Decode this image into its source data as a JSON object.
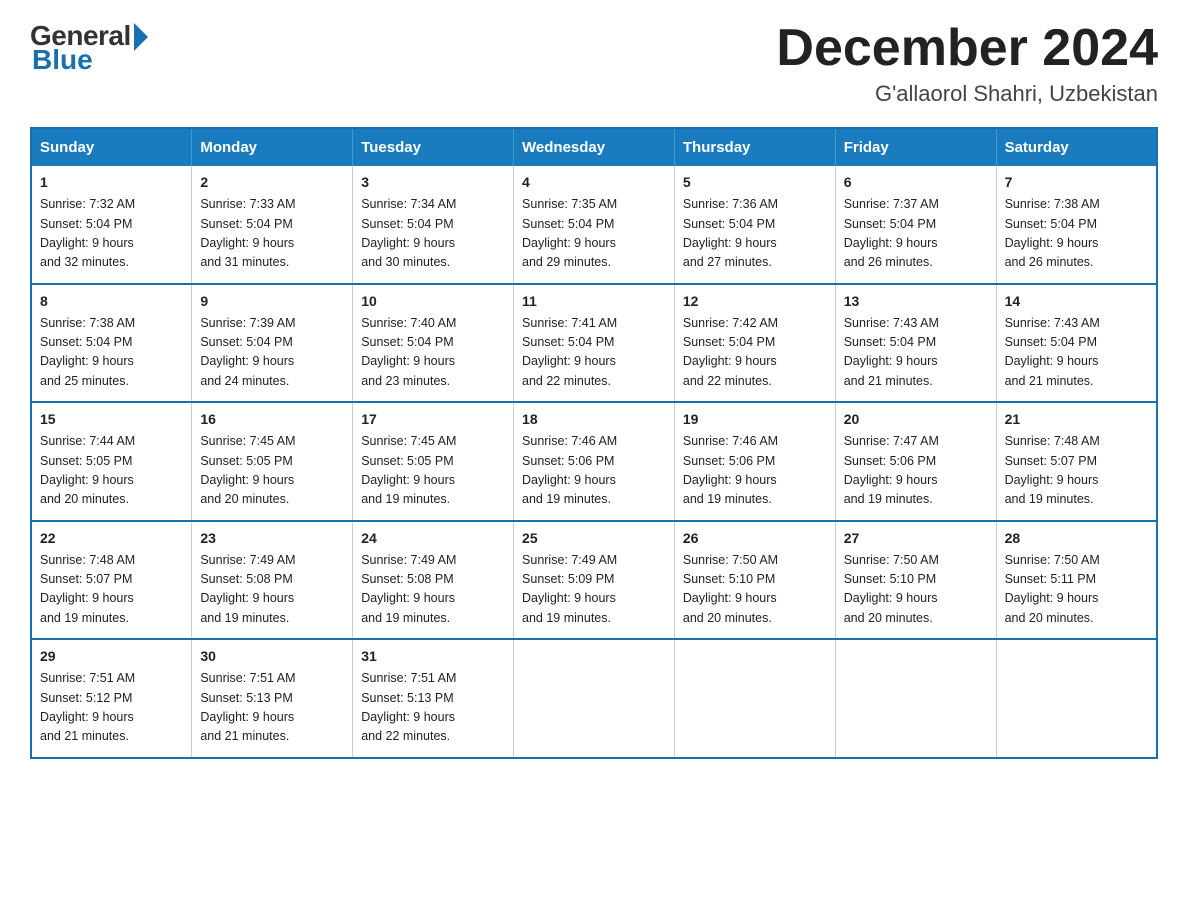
{
  "header": {
    "logo_general": "General",
    "logo_blue": "Blue",
    "month_title": "December 2024",
    "location": "G'allaorol Shahri, Uzbekistan"
  },
  "days_of_week": [
    "Sunday",
    "Monday",
    "Tuesday",
    "Wednesday",
    "Thursday",
    "Friday",
    "Saturday"
  ],
  "weeks": [
    [
      {
        "day": "1",
        "sunrise": "7:32 AM",
        "sunset": "5:04 PM",
        "daylight": "9 hours and 32 minutes."
      },
      {
        "day": "2",
        "sunrise": "7:33 AM",
        "sunset": "5:04 PM",
        "daylight": "9 hours and 31 minutes."
      },
      {
        "day": "3",
        "sunrise": "7:34 AM",
        "sunset": "5:04 PM",
        "daylight": "9 hours and 30 minutes."
      },
      {
        "day": "4",
        "sunrise": "7:35 AM",
        "sunset": "5:04 PM",
        "daylight": "9 hours and 29 minutes."
      },
      {
        "day": "5",
        "sunrise": "7:36 AM",
        "sunset": "5:04 PM",
        "daylight": "9 hours and 27 minutes."
      },
      {
        "day": "6",
        "sunrise": "7:37 AM",
        "sunset": "5:04 PM",
        "daylight": "9 hours and 26 minutes."
      },
      {
        "day": "7",
        "sunrise": "7:38 AM",
        "sunset": "5:04 PM",
        "daylight": "9 hours and 26 minutes."
      }
    ],
    [
      {
        "day": "8",
        "sunrise": "7:38 AM",
        "sunset": "5:04 PM",
        "daylight": "9 hours and 25 minutes."
      },
      {
        "day": "9",
        "sunrise": "7:39 AM",
        "sunset": "5:04 PM",
        "daylight": "9 hours and 24 minutes."
      },
      {
        "day": "10",
        "sunrise": "7:40 AM",
        "sunset": "5:04 PM",
        "daylight": "9 hours and 23 minutes."
      },
      {
        "day": "11",
        "sunrise": "7:41 AM",
        "sunset": "5:04 PM",
        "daylight": "9 hours and 22 minutes."
      },
      {
        "day": "12",
        "sunrise": "7:42 AM",
        "sunset": "5:04 PM",
        "daylight": "9 hours and 22 minutes."
      },
      {
        "day": "13",
        "sunrise": "7:43 AM",
        "sunset": "5:04 PM",
        "daylight": "9 hours and 21 minutes."
      },
      {
        "day": "14",
        "sunrise": "7:43 AM",
        "sunset": "5:04 PM",
        "daylight": "9 hours and 21 minutes."
      }
    ],
    [
      {
        "day": "15",
        "sunrise": "7:44 AM",
        "sunset": "5:05 PM",
        "daylight": "9 hours and 20 minutes."
      },
      {
        "day": "16",
        "sunrise": "7:45 AM",
        "sunset": "5:05 PM",
        "daylight": "9 hours and 20 minutes."
      },
      {
        "day": "17",
        "sunrise": "7:45 AM",
        "sunset": "5:05 PM",
        "daylight": "9 hours and 19 minutes."
      },
      {
        "day": "18",
        "sunrise": "7:46 AM",
        "sunset": "5:06 PM",
        "daylight": "9 hours and 19 minutes."
      },
      {
        "day": "19",
        "sunrise": "7:46 AM",
        "sunset": "5:06 PM",
        "daylight": "9 hours and 19 minutes."
      },
      {
        "day": "20",
        "sunrise": "7:47 AM",
        "sunset": "5:06 PM",
        "daylight": "9 hours and 19 minutes."
      },
      {
        "day": "21",
        "sunrise": "7:48 AM",
        "sunset": "5:07 PM",
        "daylight": "9 hours and 19 minutes."
      }
    ],
    [
      {
        "day": "22",
        "sunrise": "7:48 AM",
        "sunset": "5:07 PM",
        "daylight": "9 hours and 19 minutes."
      },
      {
        "day": "23",
        "sunrise": "7:49 AM",
        "sunset": "5:08 PM",
        "daylight": "9 hours and 19 minutes."
      },
      {
        "day": "24",
        "sunrise": "7:49 AM",
        "sunset": "5:08 PM",
        "daylight": "9 hours and 19 minutes."
      },
      {
        "day": "25",
        "sunrise": "7:49 AM",
        "sunset": "5:09 PM",
        "daylight": "9 hours and 19 minutes."
      },
      {
        "day": "26",
        "sunrise": "7:50 AM",
        "sunset": "5:10 PM",
        "daylight": "9 hours and 20 minutes."
      },
      {
        "day": "27",
        "sunrise": "7:50 AM",
        "sunset": "5:10 PM",
        "daylight": "9 hours and 20 minutes."
      },
      {
        "day": "28",
        "sunrise": "7:50 AM",
        "sunset": "5:11 PM",
        "daylight": "9 hours and 20 minutes."
      }
    ],
    [
      {
        "day": "29",
        "sunrise": "7:51 AM",
        "sunset": "5:12 PM",
        "daylight": "9 hours and 21 minutes."
      },
      {
        "day": "30",
        "sunrise": "7:51 AM",
        "sunset": "5:13 PM",
        "daylight": "9 hours and 21 minutes."
      },
      {
        "day": "31",
        "sunrise": "7:51 AM",
        "sunset": "5:13 PM",
        "daylight": "9 hours and 22 minutes."
      },
      null,
      null,
      null,
      null
    ]
  ],
  "labels": {
    "sunrise": "Sunrise:",
    "sunset": "Sunset:",
    "daylight": "Daylight:"
  }
}
